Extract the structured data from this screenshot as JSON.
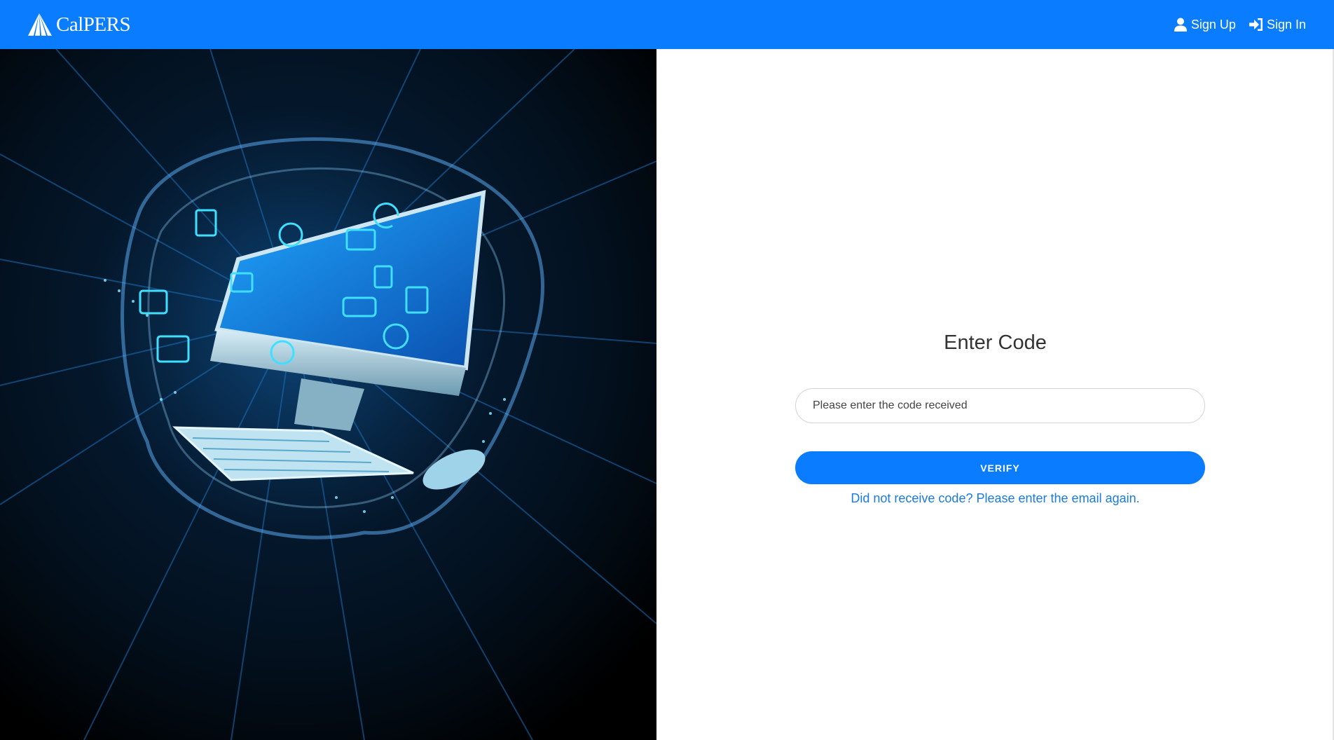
{
  "header": {
    "brand_name": "CalPERS",
    "brand_color": "#0a7cff",
    "links": [
      {
        "label": "Sign Up",
        "icon": "user-icon"
      },
      {
        "label": "Sign In",
        "icon": "sign-in-icon"
      }
    ]
  },
  "hero": {
    "image": "computer-with-floating-app-icons-splash"
  },
  "form": {
    "title": "Enter Code",
    "code_input": {
      "value": "",
      "placeholder": "Please enter the code received"
    },
    "verify_label": "VERIFY",
    "resend_link": "Did not receive code? Please enter the email again."
  }
}
